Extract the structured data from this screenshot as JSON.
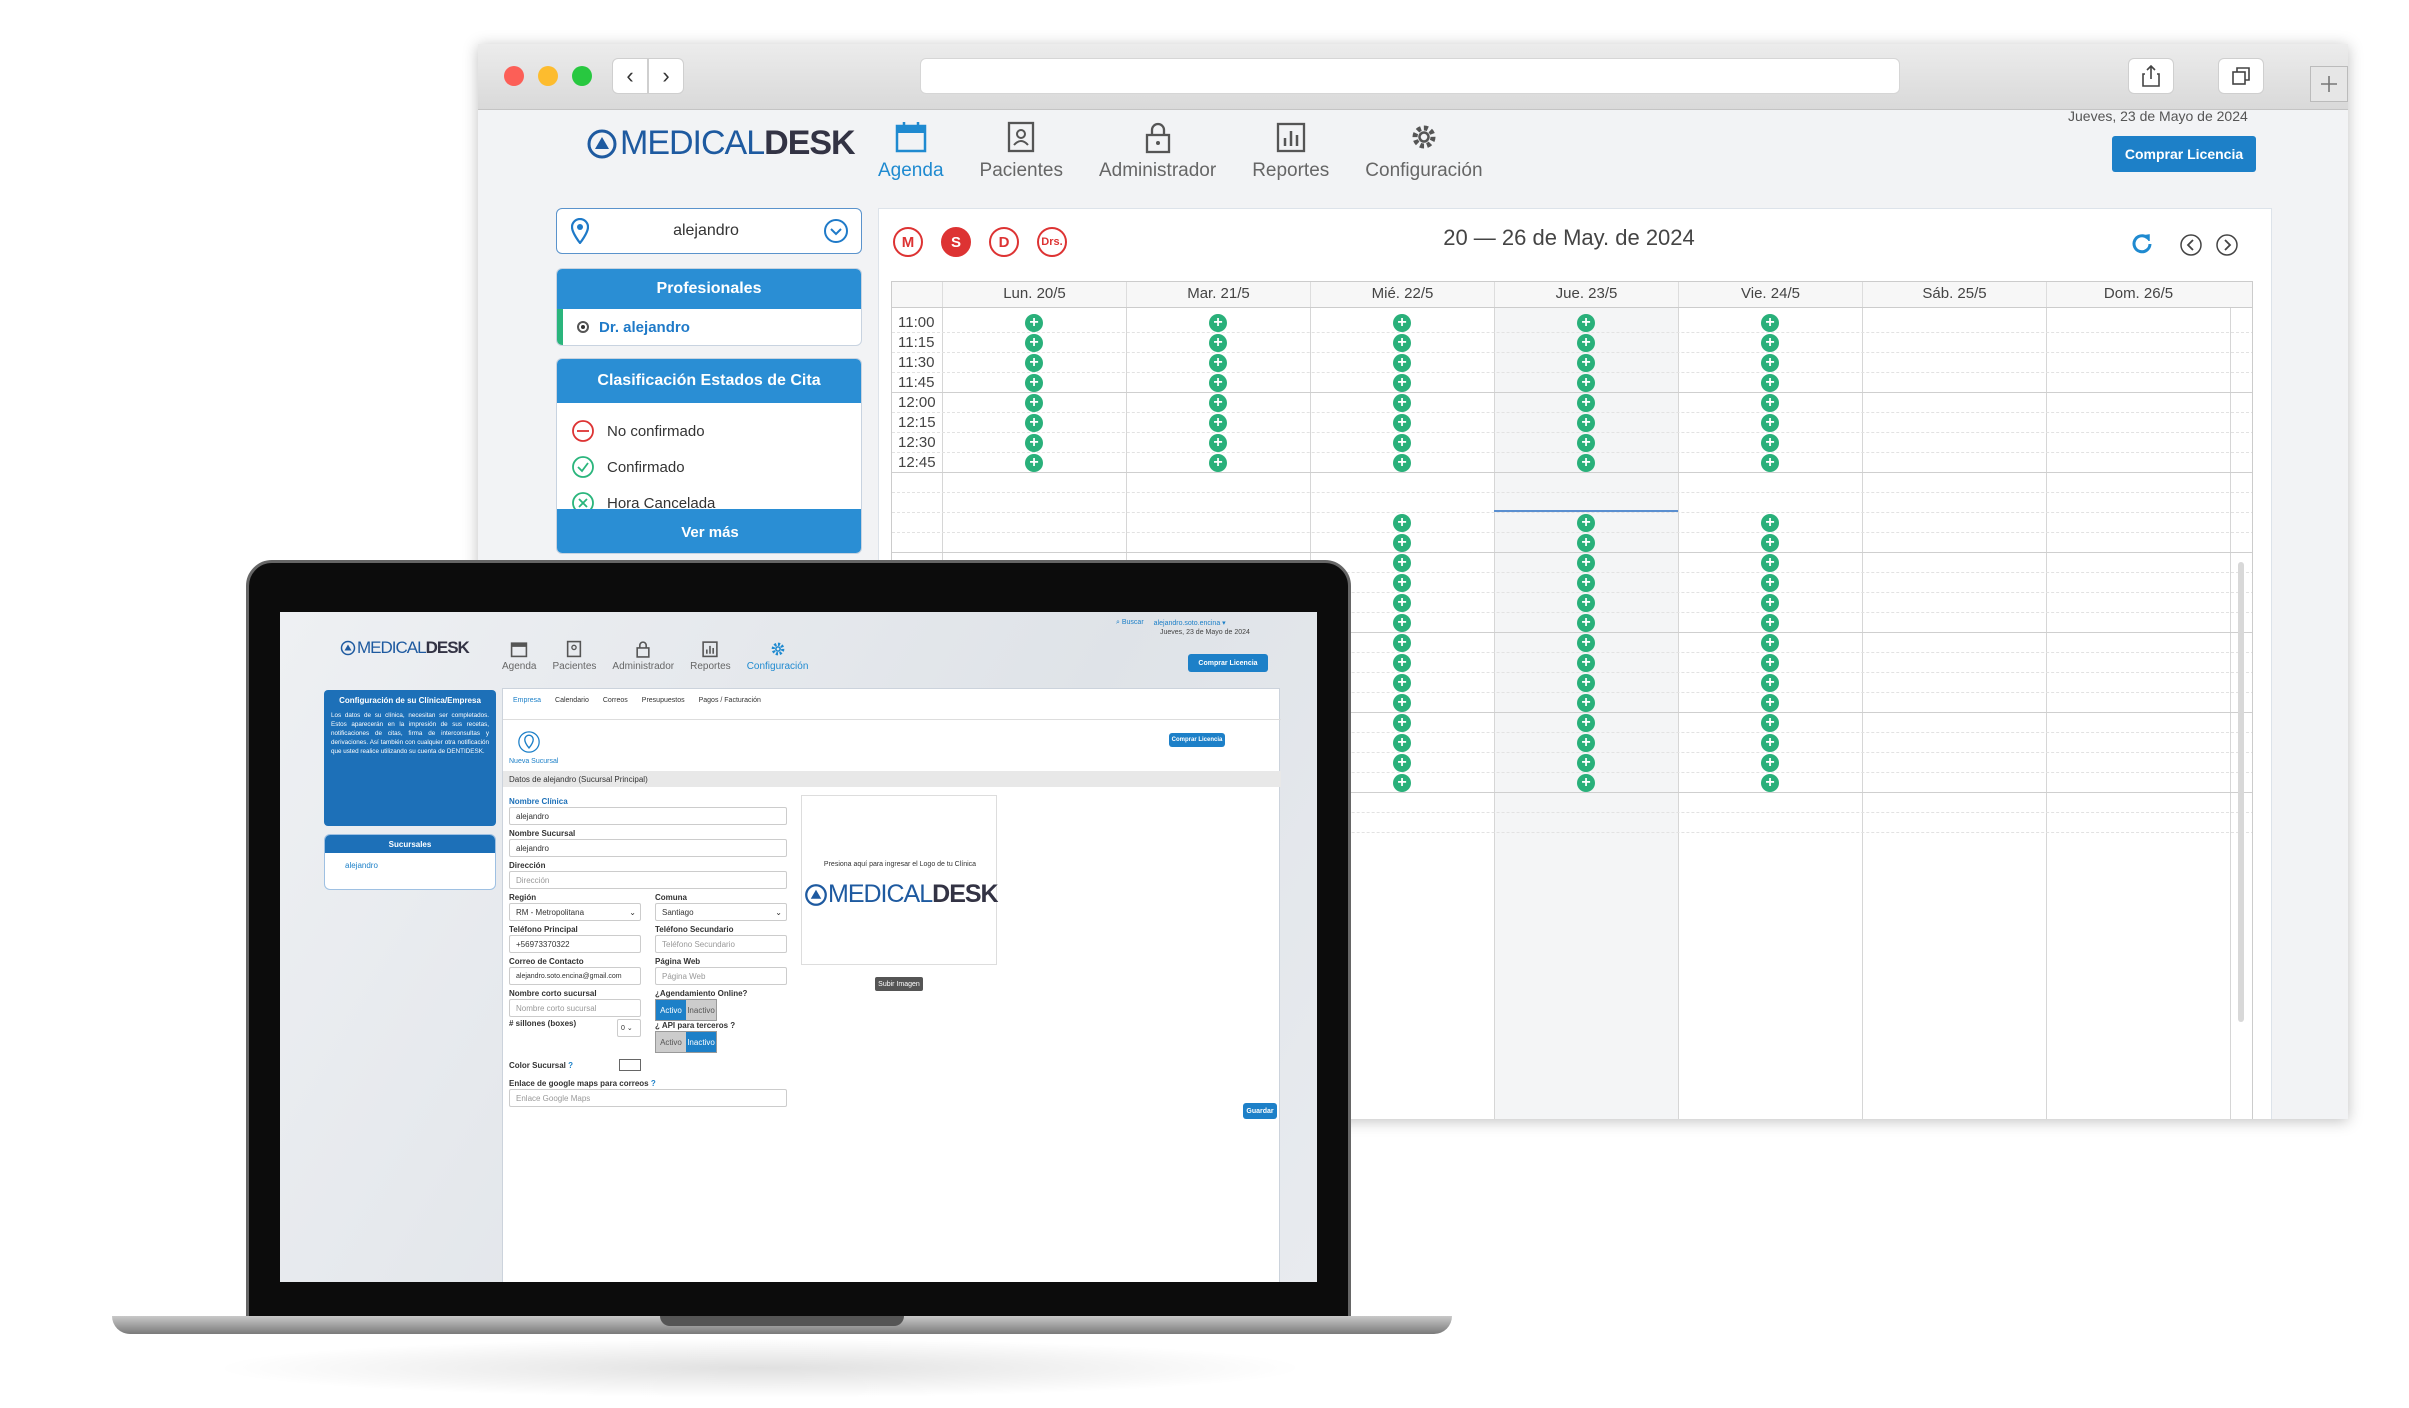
{
  "browser": {
    "nav_back": "‹",
    "nav_forward": "›"
  },
  "app": {
    "logo_brand": "MEDICAL",
    "logo_suffix": "DESK",
    "date_text": "Jueves, 23 de Mayo de 2024",
    "buy_license": "Comprar Licencia",
    "nav": [
      {
        "label": "Agenda",
        "icon": "calendar-icon",
        "active": true
      },
      {
        "label": "Pacientes",
        "icon": "contacts-icon",
        "active": false
      },
      {
        "label": "Administrador",
        "icon": "lock-icon",
        "active": false
      },
      {
        "label": "Reportes",
        "icon": "chart-icon",
        "active": false
      },
      {
        "label": "Configuración",
        "icon": "gear-icon",
        "active": false
      }
    ]
  },
  "sidebar": {
    "location_value": "alejandro",
    "professionals_title": "Profesionales",
    "professional_name": "Dr. alejandro",
    "status_title": "Clasificación Estados de Cita",
    "statuses": [
      "No confirmado",
      "Confirmado",
      "Hora Cancelada"
    ],
    "see_more": "Ver más"
  },
  "calendar": {
    "view_buttons": [
      "M",
      "S",
      "D",
      "Drs."
    ],
    "range_title": "20 — 26 de May. de 2024",
    "days": [
      "Lun. 20/5",
      "Mar. 21/5",
      "Mié. 22/5",
      "Jue. 23/5",
      "Vie. 24/5",
      "Sáb. 25/5",
      "Dom. 26/5"
    ],
    "times": [
      "11:00",
      "11:15",
      "11:30",
      "11:45",
      "12:00",
      "12:15",
      "12:30",
      "12:45"
    ],
    "slot_symbol": "+",
    "colors": {
      "accent": "#1d80c8",
      "slot": "#29b07a",
      "danger": "#d33333"
    }
  },
  "laptop": {
    "search_link": "Buscar",
    "user_menu": "alejandro.soto.encina",
    "date_text": "Jueves, 23 de Mayo de 2024",
    "buy_license": "Comprar Licencia",
    "nav": [
      {
        "label": "Agenda",
        "icon": "calendar-icon"
      },
      {
        "label": "Pacientes",
        "icon": "contacts-icon"
      },
      {
        "label": "Administrador",
        "icon": "lock-icon"
      },
      {
        "label": "Reportes",
        "icon": "chart-icon"
      },
      {
        "label": "Configuración",
        "icon": "gear-icon"
      }
    ],
    "config_box_title": "Configuración de su Clínica/Empresa",
    "config_box_text": "Los datos de su clínica, necesitan ser completados. Estos aparecerán en la impresión de sus recetas, notificaciones de citas, firma de interconsultas y derivaciones. Así también con cualquier otra notificación que usted realice utilizando su cuenta de DENTIDESK.",
    "branches_title": "Sucursales",
    "branch_item": "alejandro",
    "tabs": [
      "Empresa",
      "Calendario",
      "Correos",
      "Presupuestos",
      "Pagos / Facturación"
    ],
    "new_branch": "Nueva Sucursal",
    "section_title": "Datos de alejandro (Sucursal Principal)",
    "fields": {
      "clinic_name_label": "Nombre Clínica",
      "clinic_name_value": "alejandro",
      "branch_name_label": "Nombre Sucursal",
      "branch_name_value": "alejandro",
      "address_label": "Dirección",
      "address_placeholder": "Dirección",
      "region_label": "Región",
      "region_value": "RM - Metropolitana",
      "comuna_label": "Comuna",
      "comuna_value": "Santiago",
      "phone_label": "Teléfono Principal",
      "phone_value": "+56973370322",
      "phone2_label": "Teléfono Secundario",
      "phone2_placeholder": "Teléfono Secundario",
      "email_label": "Correo de Contacto",
      "email_value": "alejandro.soto.encina@gmail.com",
      "web_label": "Página Web",
      "web_placeholder": "Página Web",
      "short_name_label": "Nombre corto sucursal",
      "short_name_placeholder": "Nombre corto sucursal",
      "online_label": "¿Agendamiento Online?",
      "chairs_label": "# sillones (boxes)",
      "chairs_value": "0",
      "api_label": "¿ API para terceros ?",
      "active": "Activo",
      "inactive": "Inactivo",
      "color_label": "Color Sucursal",
      "maps_label": "Enlace de google maps para correos",
      "maps_placeholder": "Enlace Google Maps"
    },
    "logo_hint": "Presiona aquí para ingresar el Logo de tu Clínica",
    "upload_button": "Subir Imagen",
    "save_button": "Guardar"
  }
}
